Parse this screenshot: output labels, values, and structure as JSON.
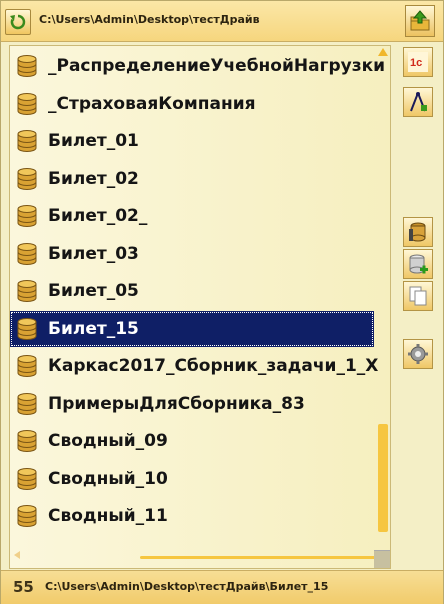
{
  "header": {
    "path": "C:\\Users\\Admin\\Desktop\\тестДрайв",
    "refresh_icon": "refresh-icon",
    "up_icon": "folder-up-icon"
  },
  "list": {
    "items": [
      {
        "label": "_РаспределениеУчебнойНагрузки",
        "selected": false
      },
      {
        "label": "_СтраховаяКомпания",
        "selected": false
      },
      {
        "label": "Билет_01",
        "selected": false
      },
      {
        "label": "Билет_02",
        "selected": false
      },
      {
        "label": "Билет_02_",
        "selected": false
      },
      {
        "label": "Билет_03",
        "selected": false
      },
      {
        "label": "Билет_05",
        "selected": false
      },
      {
        "label": "Билет_15",
        "selected": true
      },
      {
        "label": "Каркас2017_Сборник_задачи_1_Х",
        "selected": false
      },
      {
        "label": "ПримерыДляСборника_83",
        "selected": false
      },
      {
        "label": "Сводный_09",
        "selected": false
      },
      {
        "label": "Сводный_10",
        "selected": false
      },
      {
        "label": "Сводный_11",
        "selected": false
      }
    ]
  },
  "toolbar": {
    "buttons": [
      {
        "name": "1c-icon"
      },
      {
        "name": "designer-icon"
      },
      {
        "name": "database-tools-icon"
      },
      {
        "name": "add-database-icon"
      },
      {
        "name": "copy-icon"
      },
      {
        "name": "settings-gear-icon"
      }
    ]
  },
  "status": {
    "count": "55",
    "path": "C:\\Users\\Admin\\Desktop\\тестДрайв\\Билет_15"
  },
  "colors": {
    "selection": "#0f1f66",
    "accent": "#f6c640",
    "background": "#f4efc6"
  }
}
